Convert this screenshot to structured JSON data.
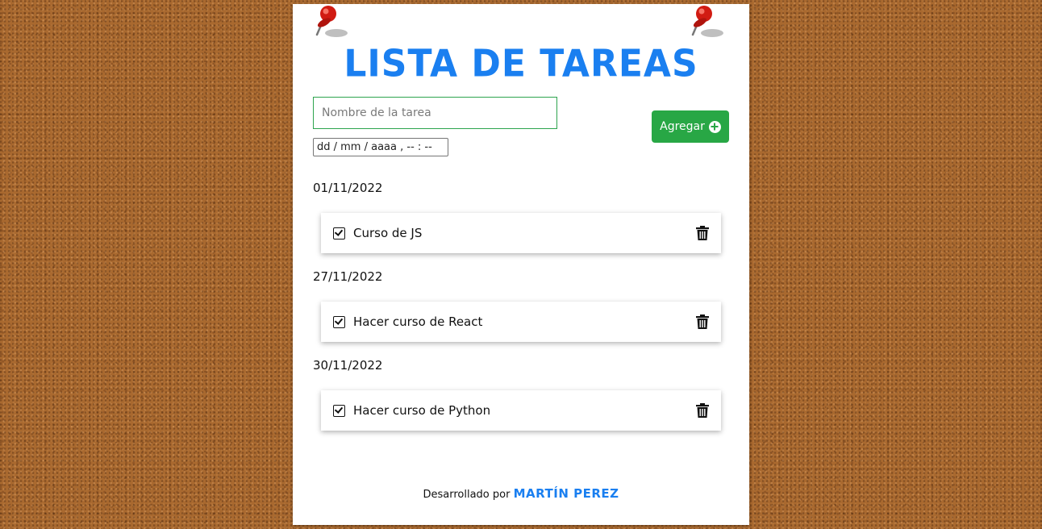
{
  "app": {
    "title": "LISTA DE TAREAS"
  },
  "form": {
    "task_placeholder": "Nombre de la tarea",
    "task_value": "",
    "date_placeholder": "dd / mm / aaaa ,  -- : --",
    "add_label": "Agregar"
  },
  "groups": [
    {
      "date": "01/11/2022",
      "tasks": [
        {
          "text": "Curso de JS"
        }
      ]
    },
    {
      "date": "27/11/2022",
      "tasks": [
        {
          "text": "Hacer curso de React"
        }
      ]
    },
    {
      "date": "30/11/2022",
      "tasks": [
        {
          "text": "Hacer curso de Python"
        }
      ]
    }
  ],
  "footer": {
    "prefix": "Desarrollado por",
    "author": "MARTÍN PEREZ"
  },
  "colors": {
    "accent": "#1a7ff0",
    "button": "#28a745",
    "board": "#a9692f"
  },
  "icons": {
    "pin": "pushpin-icon",
    "add": "plus-circle-icon",
    "check": "check-square-icon",
    "delete": "trash-icon"
  }
}
